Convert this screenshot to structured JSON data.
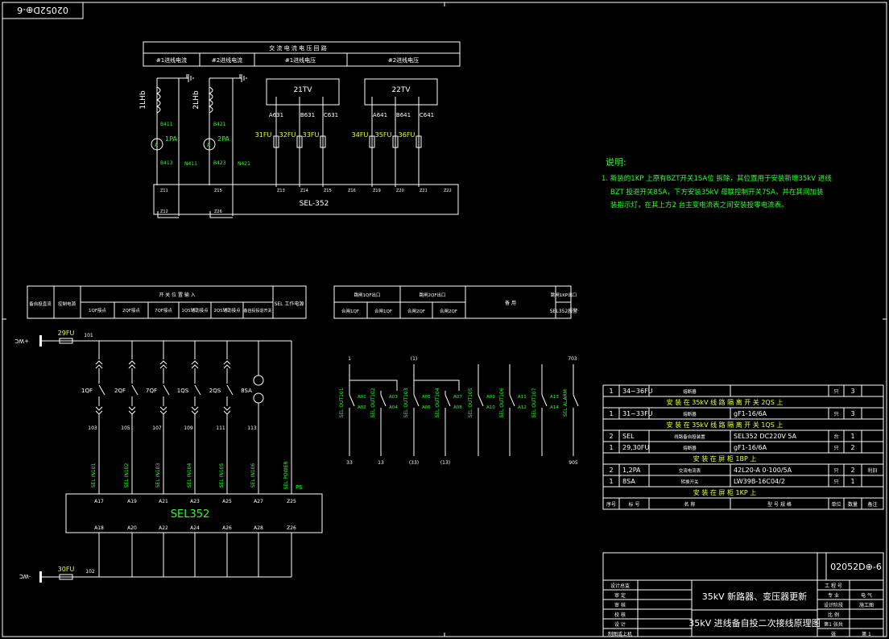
{
  "drawing": {
    "stamp_top_left": "02052D⊕-6",
    "drawing_number": "02052D⊕-6",
    "title_project": "35kV 新路器、变压器更新",
    "title_drawing": "35kV 进线备自投二次接线原理图"
  },
  "ac_table": {
    "title": "交 流 电 流 电 压 回 路",
    "cols": [
      "#1进线电流",
      "#2进线电流",
      "#1进线电压",
      "#2进线电压"
    ]
  },
  "ac_circuit": {
    "ct1": "1LHb",
    "ct2": "2LHb",
    "pa1": "1PA",
    "pa2": "2PA",
    "wires": [
      "B411",
      "B413",
      "N411",
      "B421",
      "B423",
      "N421"
    ],
    "tv1": "21TV",
    "tv2": "22TV",
    "tv1_phases": [
      "A631",
      "B631",
      "C631"
    ],
    "tv2_phases": [
      "A641",
      "B641",
      "C641"
    ],
    "fuses1": [
      "31FU",
      "32FU",
      "33FU"
    ],
    "fuses2": [
      "34FU",
      "35FU",
      "36FU"
    ],
    "relay": "SEL-352",
    "terminals": [
      "Z11",
      "Z13",
      "Z14",
      "Z15",
      "Z16",
      "Z19",
      "Z20",
      "Z21",
      "Z22",
      "Z12",
      "Z26"
    ]
  },
  "notes": {
    "heading": "说明:",
    "line1": "1. 新装的1KP 上原有BZT开关1SA位 拆除，其位置用于安装新增35kV 进线",
    "line2": "BZT 投退开关8SA，下方安装35kV 母联控制开关7SA，并在其间加装",
    "line3": "装指示灯，在其上方2 台主变电流表之间安装投零电流表。"
  },
  "dc_table": {
    "h1": "备自投直流",
    "h2": "控制电源",
    "h3": "开 关 位 置 输 入",
    "sub": [
      "1QF接点",
      "2QF接点",
      "7QF接点",
      "1QS辅助接点",
      "2QS辅助接点",
      "备自投投退开关"
    ],
    "h4": "SEL 工作电源"
  },
  "out_table": {
    "h1": "跳闸1QF出口",
    "h2": "跳闸2QF出口",
    "h3": "备 用",
    "h4": "跳闸1KP出口",
    "s1": "合闸1QF",
    "s2": "合闸1QF",
    "s3": "合闸2QF",
    "s4": "合闸2QF",
    "s5": "SEL352报警"
  },
  "dc_circuit": {
    "pos": "+WC",
    "neg": "-WC",
    "fuse_top": "29FU",
    "fuse_bot": "30FU",
    "node_top": "101",
    "node_bot": "102",
    "switches": [
      "1QF",
      "2QF",
      "7QF",
      "1QS",
      "2QS",
      "8SA"
    ],
    "nodes": [
      "103",
      "105",
      "107",
      "109",
      "111",
      "113"
    ],
    "inputs": [
      "SEL IN101",
      "SEL IN102",
      "SEL IN103",
      "SEL IN104",
      "SEL IN105",
      "SEL IN106",
      "SEL POWER"
    ],
    "ps": "PS",
    "top_pins": [
      "A17",
      "A19",
      "A21",
      "A23",
      "A25",
      "A27",
      "Z25"
    ],
    "bot_pins": [
      "A18",
      "A20",
      "A22",
      "A24",
      "A26",
      "A28",
      "Z26"
    ],
    "relay": "SEL352"
  },
  "out_circuit": {
    "top_labels": [
      "1",
      "(1)",
      "703"
    ],
    "outs": [
      "SEL OUT101",
      "SEL OUT102",
      "SEL OUT103",
      "SEL OUT104",
      "SEL OUT105",
      "SEL OUT106",
      "SEL OUT107",
      "SEL ALARM"
    ],
    "pins": [
      "A01",
      "A02",
      "A03",
      "A04",
      "A05",
      "A06",
      "A07",
      "A08",
      "A09",
      "A10",
      "A11",
      "A12",
      "A13",
      "A14"
    ],
    "bottom_labels": [
      "33",
      "13",
      "(33)",
      "(13)",
      "905"
    ]
  },
  "bom": {
    "rows": [
      {
        "no": "1",
        "code": "34~36FU",
        "name": "熔断器",
        "spec": "",
        "unit": "只",
        "qty": "3",
        "note": ""
      },
      {
        "group": "安 装 在 35kV 线 路 隔 离 开 关 2QS 上"
      },
      {
        "no": "1",
        "code": "31~33FU",
        "name": "熔断器",
        "spec": "gF1-16/6A",
        "unit": "只",
        "qty": "3",
        "note": ""
      },
      {
        "group": "安 装 在 35kV 线 路 隔 离 开 关 1QS 上"
      },
      {
        "no": "2",
        "code": "SEL",
        "name": "线路备自投装置",
        "spec": "SEL352 DC220V 5A",
        "unit": "台",
        "qty": "1",
        "note": ""
      },
      {
        "no": "1",
        "code": "29,30FU",
        "name": "熔断器",
        "spec": "gF1-16/6A",
        "unit": "只",
        "qty": "2",
        "note": ""
      },
      {
        "group": "安 装 在 屏 柜 1BP 上"
      },
      {
        "no": "2",
        "code": "1,2PA",
        "name": "交流电流表",
        "spec": "42L20-A 0-100/5A",
        "unit": "只",
        "qty": "2",
        "note": "利旧"
      },
      {
        "no": "1",
        "code": "8SA",
        "name": "转换开关",
        "spec": "LW39B-16C04/2",
        "unit": "只",
        "qty": "1",
        "note": ""
      },
      {
        "group": "安 装 在 屏 柜 1KP 上"
      }
    ],
    "header": [
      "序号",
      "标 号",
      "名 称",
      "型 号 规 格",
      "单位",
      "数量",
      "备注"
    ]
  },
  "title_block": {
    "left": [
      "设计总监",
      "审 定",
      "审 核",
      "校 核",
      "设 计",
      "制图或上机"
    ],
    "right": [
      "工 程 号",
      "专 业",
      "设计阶段",
      "比 例",
      "第1 张共",
      "张"
    ],
    "right_vals": [
      "",
      "电 气",
      "施工图",
      "",
      "",
      "第 1"
    ]
  }
}
